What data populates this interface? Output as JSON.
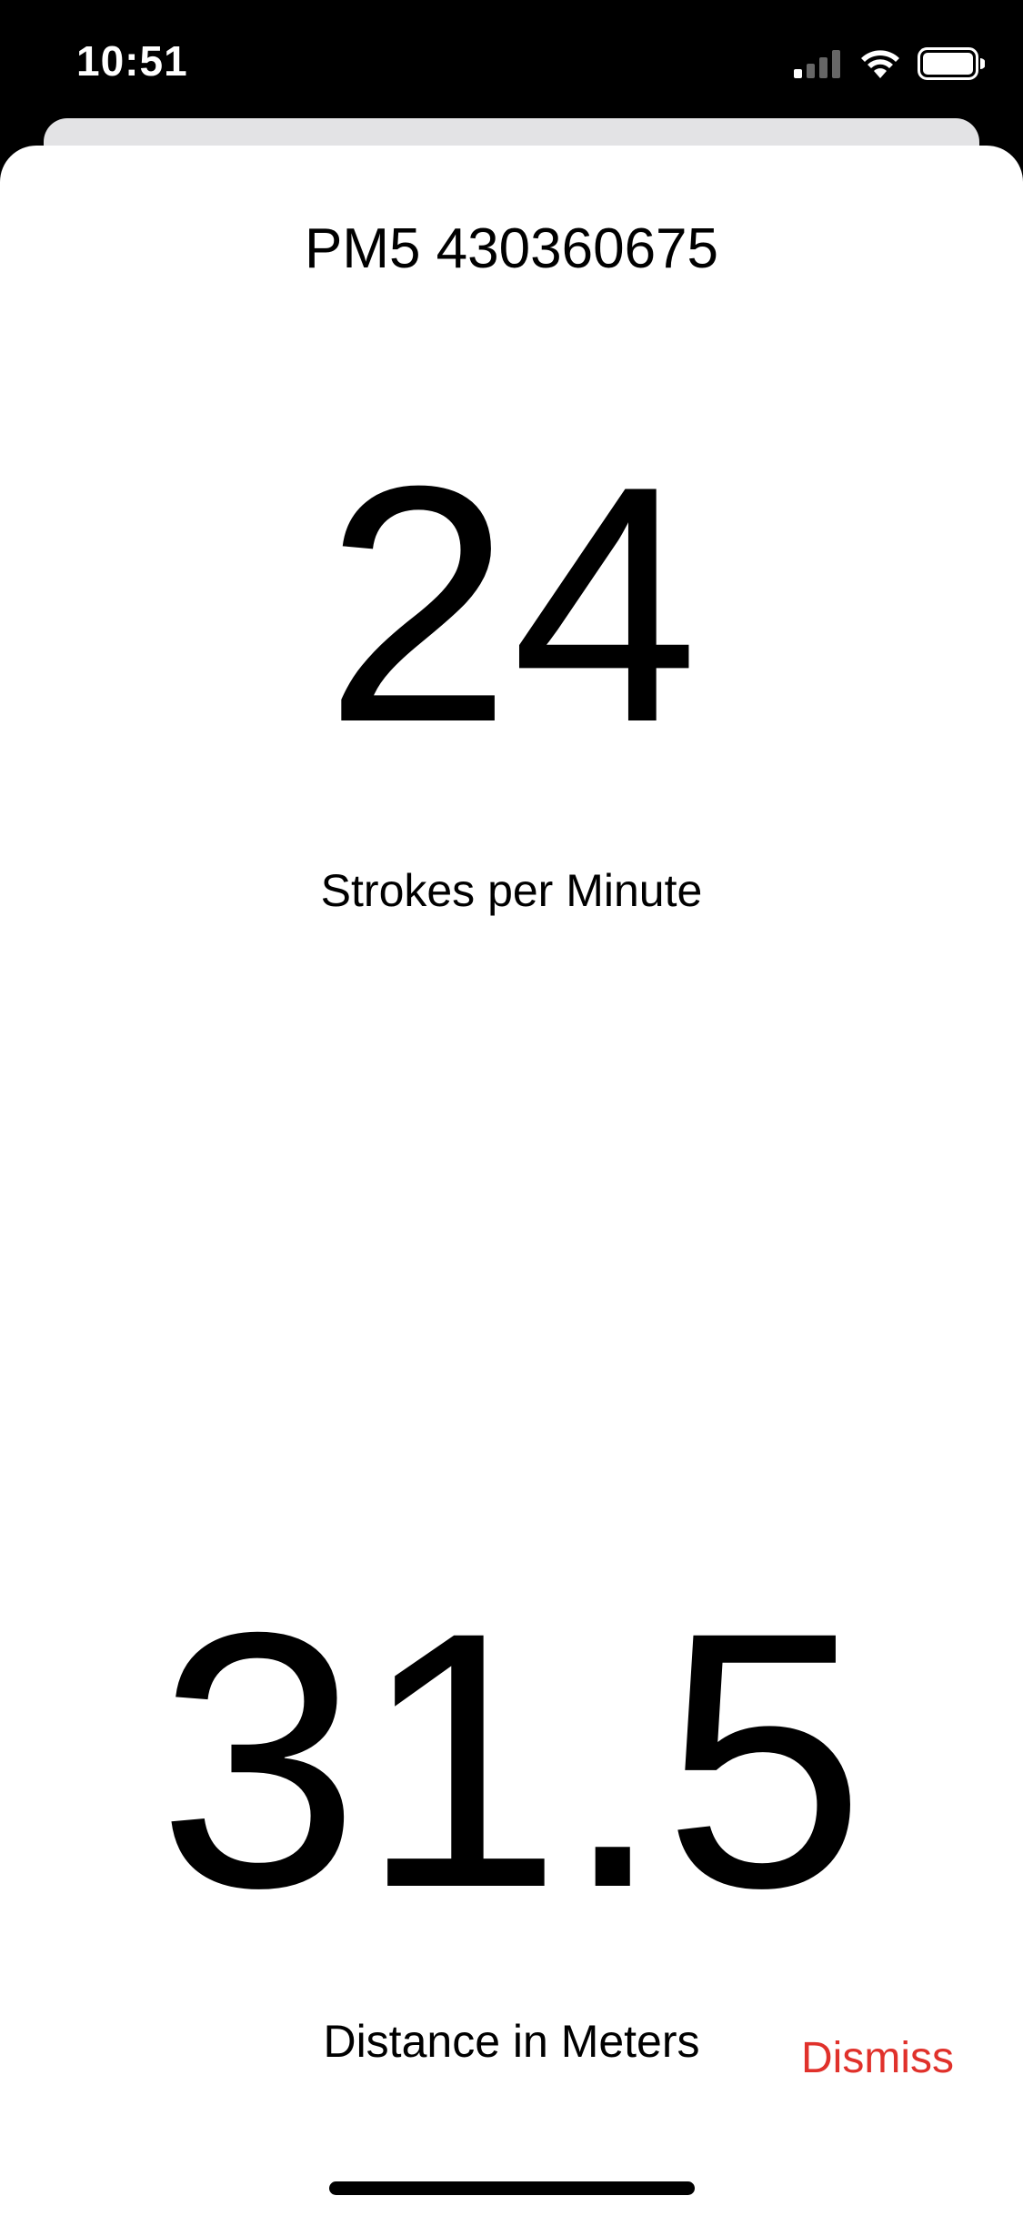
{
  "status_bar": {
    "time": "10:51",
    "icons": [
      "cellular-signal-icon",
      "wifi-icon",
      "battery-icon"
    ]
  },
  "device": {
    "title": "PM5 430360675"
  },
  "metrics": {
    "strokes_per_minute": {
      "value": "24",
      "label": "Strokes per Minute"
    },
    "distance": {
      "value": "31.5",
      "label": "Distance in Meters"
    }
  },
  "actions": {
    "dismiss_label": "Dismiss"
  },
  "colors": {
    "accent": "#e0312b",
    "background": "#ffffff",
    "status_bar": "#000000"
  }
}
